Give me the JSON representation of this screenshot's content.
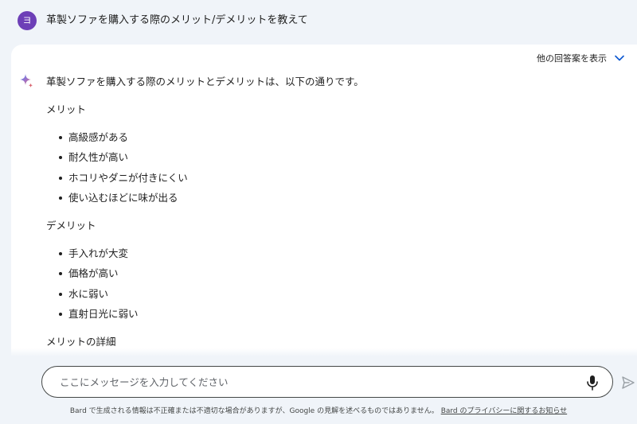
{
  "prompt": {
    "avatar_letter": "ヨ",
    "text": "革製ソファを購入する際のメリット/デメリットを教えて"
  },
  "response": {
    "drafts_label": "他の回答案を表示",
    "intro": "革製ソファを購入する際のメリットとデメリットは、以下の通りです。",
    "merit_title": "メリット",
    "merits": [
      "高級感がある",
      "耐久性が高い",
      "ホコリやダニが付きにくい",
      "使い込むほどに味が出る"
    ],
    "demerit_title": "デメリット",
    "demerits": [
      "手入れが大変",
      "価格が高い",
      "水に弱い",
      "直射日光に弱い"
    ],
    "detail_title": "メリットの詳細"
  },
  "input": {
    "placeholder": "ここにメッセージを入力してください"
  },
  "footer": {
    "disclaimer": "Bard で生成される情報は不正確または不適切な場合がありますが、Google の見解を述べるものではありません。",
    "privacy_link": "Bard のプライバシーに関するお知らせ"
  },
  "colors": {
    "background": "#f0f4f9",
    "avatar": "#6d3fb7",
    "accent_blue": "#0b57d0"
  },
  "icons": {
    "drafts": "chevron-down-icon",
    "assistant": "sparkle-icon",
    "mic": "microphone-icon",
    "send": "send-icon"
  }
}
